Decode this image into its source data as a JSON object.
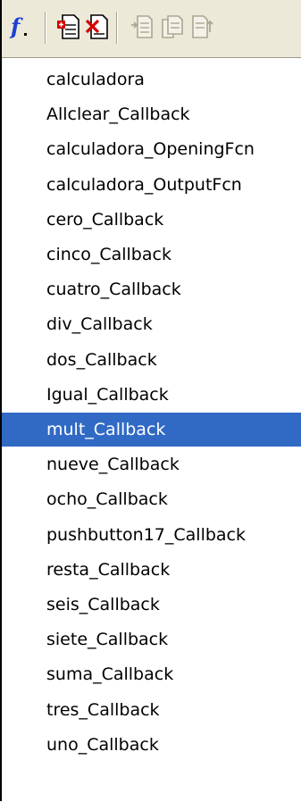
{
  "toolbar": {
    "buttons": [
      {
        "name": "function-menu-icon",
        "glyph": "f",
        "enabled": true
      },
      {
        "name": "insert-function-icon",
        "enabled": true
      },
      {
        "name": "delete-function-icon",
        "enabled": true
      },
      {
        "name": "copy-function-icon",
        "enabled": false
      },
      {
        "name": "paste-function-icon",
        "enabled": false
      },
      {
        "name": "move-function-icon",
        "enabled": false
      }
    ]
  },
  "functions": {
    "items": [
      "calculadora",
      "Allclear_Callback",
      "calculadora_OpeningFcn",
      "calculadora_OutputFcn",
      "cero_Callback",
      "cinco_Callback",
      "cuatro_Callback",
      "div_Callback",
      "dos_Callback",
      "Igual_Callback",
      "mult_Callback",
      "nueve_Callback",
      "ocho_Callback",
      "pushbutton17_Callback",
      "resta_Callback",
      "seis_Callback",
      "siete_Callback",
      "suma_Callback",
      "tres_Callback",
      "uno_Callback"
    ],
    "selected": "mult_Callback"
  },
  "colors": {
    "selection": "#316ac5",
    "toolbar": "#ece9d8",
    "function_glyph": "#1f3fd6",
    "delete_mark": "#d40000"
  }
}
